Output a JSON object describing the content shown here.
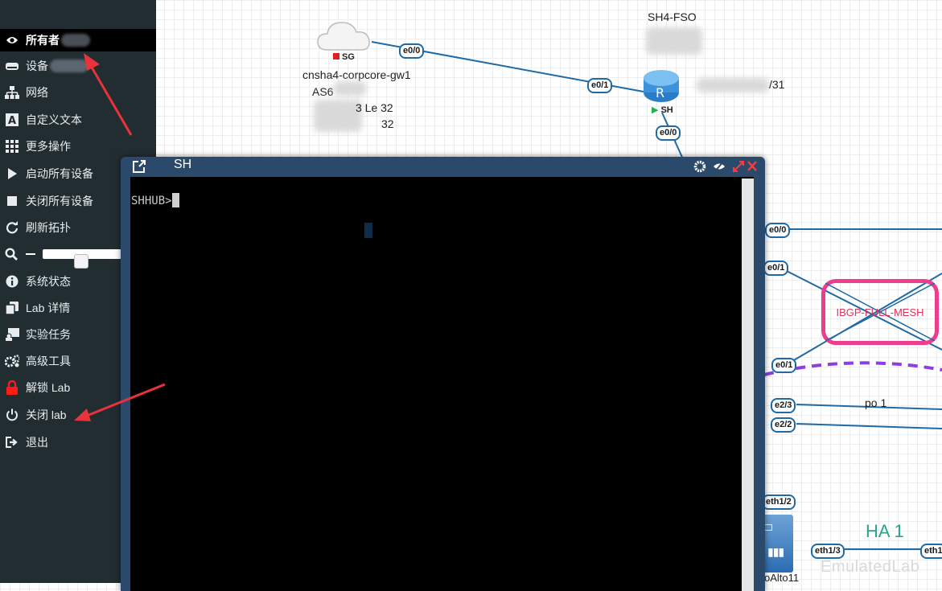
{
  "sidebar": {
    "owner": {
      "label": "所有者 ",
      "icon": "eye-icon"
    },
    "items": [
      {
        "label": "设备",
        "icon": "devices-icon"
      },
      {
        "label": "网络",
        "icon": "network-icon"
      },
      {
        "label": "自定义文本",
        "icon": "text-icon"
      },
      {
        "label": "更多操作",
        "icon": "grid-icon"
      },
      {
        "label": "启动所有设备",
        "icon": "play-icon"
      },
      {
        "label": "关闭所有设备",
        "icon": "stop-icon"
      },
      {
        "label": "刷新拓扑",
        "icon": "refresh-icon"
      },
      {
        "label": "系统状态",
        "icon": "info-icon"
      },
      {
        "label": "Lab 详情",
        "icon": "copy-icon"
      },
      {
        "label": "实验任务",
        "icon": "tasks-icon"
      },
      {
        "label": "高级工具",
        "icon": "cogs-icon"
      },
      {
        "label": "解锁 Lab",
        "icon": "lock-icon"
      },
      {
        "label": "关闭 lab",
        "icon": "power-icon"
      },
      {
        "label": "退出",
        "icon": "logout-icon"
      }
    ],
    "zoom": {
      "icon": "search-icon",
      "level": 0.47
    }
  },
  "topology": {
    "cloud": {
      "label": "cnsha4-corpcore-gw1",
      "badge": "SG",
      "as_label": "AS6",
      "le1": "3 Le 32",
      "le2": "32"
    },
    "router": {
      "name": "SH",
      "label_top": "SH4-FSO",
      "ip_label": "/31"
    },
    "interfaces": {
      "cloud_e00": "e0/0",
      "router_e01": "e0/1",
      "router_e00": "e0/0",
      "r_e00": "e0/0",
      "r_e01": "e0/1",
      "r_e01b": "e0/1",
      "e23": "e2/3",
      "e22": "e2/2",
      "eth12": "eth1/2",
      "eth13": "eth1/3",
      "eth1": "eth1"
    },
    "mesh_label": "IBGP-FULL-MESH",
    "po_label": "po 1",
    "ha_label": "HA 1",
    "pa_label": "oAlto11",
    "watermark": "EmulatedLab"
  },
  "console": {
    "title": "SH",
    "prompt": "SHHUB>"
  },
  "colors": {
    "sidebar_bg": "#222d32",
    "console_frame": "#2b4a6b",
    "link": "#1f6aa5",
    "mesh": "#ef3d8d",
    "ha": "#2ca48c",
    "arrow": "#e8323c"
  }
}
